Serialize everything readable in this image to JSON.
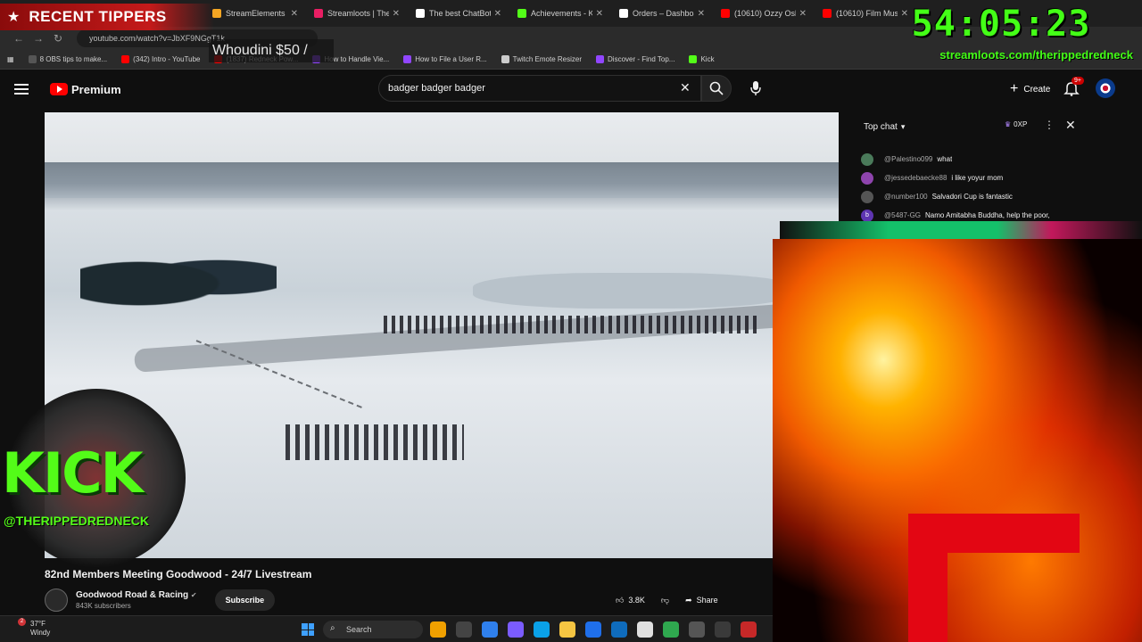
{
  "overlay": {
    "tippers_title": "RECENT TIPPERS",
    "tipper": "Whoudini $50 /",
    "timer": "54:05:23",
    "timer_url": "streamloots.com/therippedredneck",
    "kick_text": "KICK",
    "kick_handle": "@THERIPPEDREDNECK"
  },
  "browser": {
    "tabs": [
      {
        "label": "StreamElements -",
        "color": "#f5a623"
      },
      {
        "label": "Streamloots | The",
        "color": "#e91e63"
      },
      {
        "label": "The best ChatBot",
        "color": "#ffffff"
      },
      {
        "label": "Achievements - K",
        "color": "#53fc18"
      },
      {
        "label": "Orders – Dashboa",
        "color": "#ffffff"
      },
      {
        "label": "(10610) Ozzy Osb",
        "color": "#ff0000"
      },
      {
        "label": "(10610) Film Musi",
        "color": "#ff0000"
      }
    ],
    "url": "youtube.com/watch?v=JbXF9NGgT1k",
    "bookmarks": [
      {
        "label": "8 OBS tips to make...",
        "color": "#555555"
      },
      {
        "label": "(342) Intro - YouTube",
        "color": "#ff0000"
      },
      {
        "label": "(1837) Redneck Pow...",
        "color": "#ff0000"
      },
      {
        "label": "How to Handle Vie...",
        "color": "#9146ff"
      },
      {
        "label": "How to File a User R...",
        "color": "#9146ff"
      },
      {
        "label": "Twitch Emote Resizer",
        "color": "#cccccc"
      },
      {
        "label": "Discover - Find Top...",
        "color": "#9146ff"
      },
      {
        "label": "Kick",
        "color": "#53fc18"
      }
    ]
  },
  "youtube": {
    "logo_text": "Premium",
    "search_value": "badger badger badger",
    "create_label": "Create",
    "notif_badge": "9+",
    "video_title": "82nd Members Meeting Goodwood - 24/7 Livestream",
    "channel_name": "Goodwood Road & Racing",
    "channel_subs": "843K subscribers",
    "subscribe_label": "Subscribe",
    "like_count": "3.8K",
    "share_label": "Share"
  },
  "chat": {
    "title": "Top chat",
    "xp": "0XP",
    "messages": [
      {
        "author": "@Palestino099",
        "text": "what",
        "color": "#4a7a5a",
        "initial": ""
      },
      {
        "author": "@jessedebaecke88",
        "text": "i like yoyur mom",
        "color": "#8e44ad",
        "initial": ""
      },
      {
        "author": "@number100",
        "text": "Salvadori Cup is fantastic",
        "color": "#555555",
        "initial": ""
      },
      {
        "author": "@5487-GG",
        "text": "Namo Amitabha Buddha, help the poor,",
        "color": "#5e35b1",
        "initial": "b"
      }
    ]
  },
  "taskbar": {
    "temp": "37°F",
    "condition": "Windy",
    "badge": "2",
    "search_label": "Search",
    "icons": [
      "#f0a000",
      "#444444",
      "#2f80ed",
      "#7b5cff",
      "#0aa1e8",
      "#f5c542",
      "#1f6feb",
      "#0f6cbd",
      "#e0e0e0",
      "#2fa84f",
      "#555555",
      "#3a3a3a",
      "#c62828"
    ]
  }
}
